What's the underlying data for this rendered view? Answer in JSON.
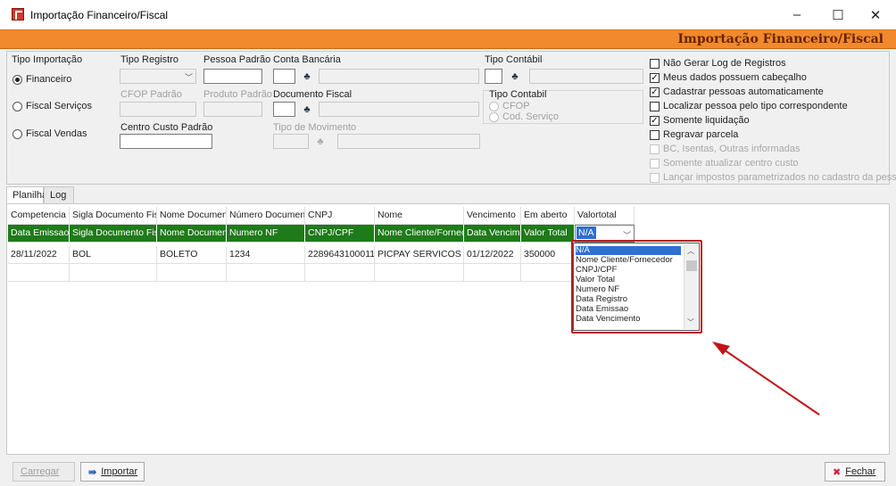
{
  "window": {
    "title": "Importação Financeiro/Fiscal",
    "minimize": "–",
    "maximize": "☐",
    "close": "✕"
  },
  "header": {
    "title": "Importação Financeiro/Fiscal"
  },
  "form": {
    "tipo_importacao": {
      "label": "Tipo Importação",
      "options": [
        "Financeiro",
        "Fiscal Serviços",
        "Fiscal Vendas"
      ],
      "selected": "Financeiro"
    },
    "tipo_registro": {
      "label": "Tipo Registro"
    },
    "pessoa_padrao": {
      "label": "Pessoa Padrão"
    },
    "conta_bancaria": {
      "label": "Conta Bancária"
    },
    "cfop_padrao": {
      "label": "CFOP Padrão"
    },
    "produto_padrao": {
      "label": "Produto Padrão"
    },
    "documento_fiscal": {
      "label": "Documento Fiscal"
    },
    "centro_custo_padrao": {
      "label": "Centro Custo Padrão"
    },
    "tipo_movimento": {
      "label": "Tipo de Movimento"
    },
    "tipo_contabil": {
      "label": "Tipo Contábil"
    },
    "tipo_contabil_group": {
      "label": "Tipo Contabil",
      "options": [
        "CFOP",
        "Cod. Serviço"
      ]
    }
  },
  "options": [
    {
      "label": "Não Gerar Log de Registros",
      "checked": false,
      "enabled": true
    },
    {
      "label": "Meus dados possuem cabeçalho",
      "checked": true,
      "enabled": true
    },
    {
      "label": "Cadastrar pessoas automaticamente",
      "checked": true,
      "enabled": true
    },
    {
      "label": "Localizar pessoa pelo tipo correspondente",
      "checked": false,
      "enabled": true
    },
    {
      "label": "Somente liquidação",
      "checked": true,
      "enabled": true
    },
    {
      "label": "Regravar parcela",
      "checked": false,
      "enabled": true
    },
    {
      "label": "BC, Isentas, Outras informadas",
      "checked": false,
      "enabled": false
    },
    {
      "label": "Somente atualizar centro custo",
      "checked": false,
      "enabled": false
    },
    {
      "label": "Lançar impostos parametrizados no cadastro da pessoa",
      "checked": false,
      "enabled": false
    }
  ],
  "tabs": [
    "Planilha",
    "Log"
  ],
  "grid": {
    "headers": [
      "Competencia",
      "Sigla Documento Fisca",
      "Nome Documento",
      "Número Documento",
      "CNPJ",
      "Nome",
      "Vencimento",
      "Em aberto",
      "Valortotal"
    ],
    "mapping": [
      "Data Emissao",
      "Sigla Documento Fisca",
      "Nome Documento",
      "Numero NF",
      "CNPJ/CPF",
      "Nome Cliente/Fornece",
      "Data Vencime",
      "Valor Total",
      "N/A"
    ],
    "rows": [
      [
        "28/11/2022",
        "BOL",
        "BOLETO",
        "1234",
        "22896431000110",
        "PICPAY SERVICOS S.A",
        "01/12/2022",
        "350000",
        ""
      ]
    ]
  },
  "dropdown": {
    "items": [
      "N/A",
      "Nome Cliente/Fornecedor",
      "CNPJ/CPF",
      "Valor Total",
      "Numero NF",
      "Data Registro",
      "Data Emissao",
      "Data Vencimento"
    ],
    "selected": "N/A"
  },
  "buttons": {
    "carregar": "Carregar",
    "importar": "Importar",
    "fechar": "Fechar"
  },
  "colors": {
    "accent_orange": "#f08a2c",
    "mapping_green": "#1f7a1a",
    "annotation_red": "#c0141a",
    "selection_blue": "#2f6fd3"
  }
}
